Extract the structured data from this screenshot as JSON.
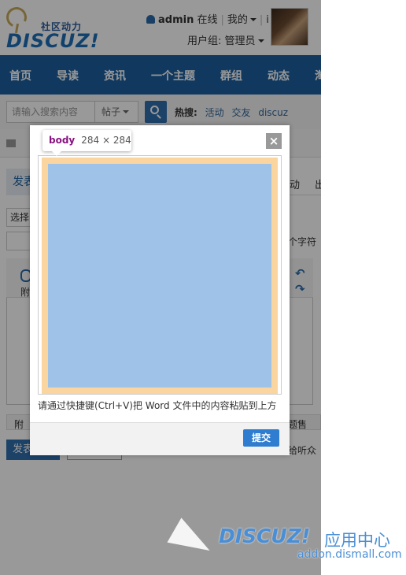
{
  "header": {
    "logo_cn": "社区动力",
    "logo_en": "DISCUZ!",
    "username": "admin",
    "online_status": "在线",
    "my_menu": "我的",
    "more_cut": "i",
    "user_group": "用户组: 管理员"
  },
  "nav": {
    "items": [
      "首页",
      "导读",
      "资讯",
      "一个主题",
      "群组",
      "动态",
      "淘"
    ]
  },
  "search": {
    "placeholder": "请输入搜索内容",
    "scope": "帖子",
    "hot_label": "热搜:",
    "hot_terms": [
      "活动",
      "交友",
      "discuz"
    ]
  },
  "background": {
    "tab_partial": "发表",
    "tab_right_1": "动",
    "tab_right_2": "出",
    "select_partial": "选择",
    "char_limit_partial": "个字符",
    "attach_partial": "附",
    "option_left_partial": "附",
    "option_right_partial": "题售",
    "post_partial": "发表",
    "listen_partial": "给听众"
  },
  "dialog": {
    "inspect_tag": "body",
    "inspect_size": "284 × 284",
    "close_label": "×",
    "hint": "请通过快捷键(Ctrl+V)把 Word 文件中的内容粘贴到上方",
    "submit_label": "提交"
  },
  "watermark": {
    "brand": "DISCUZ!",
    "center": "应用中心",
    "url": "addon.dismall.com"
  },
  "colors": {
    "nav_bg": "#1d5f9e",
    "accent": "#2f7dd0",
    "padding_orange": "#fbd5a0",
    "body_blue": "#9fc3e8"
  }
}
